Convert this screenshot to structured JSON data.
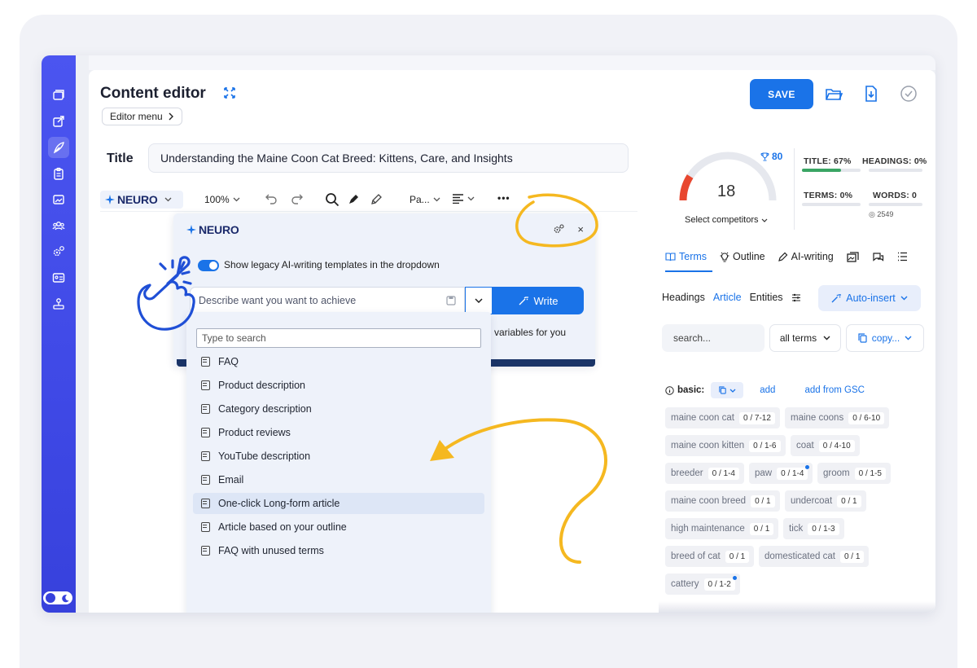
{
  "header": {
    "title": "Content editor",
    "editor_menu_label": "Editor menu",
    "save_label": "SAVE"
  },
  "document": {
    "title_label": "Title",
    "title_value": "Understanding the Maine Coon Cat Breed: Kittens, Care, and Insights"
  },
  "toolbar": {
    "neuro_label": "NEURO",
    "zoom": "100%",
    "paragraph": "Pa...",
    "more": "•••"
  },
  "neuro_popup": {
    "logo": "NEURO",
    "close": "×",
    "toggle_label": "Show legacy AI-writing templates in the dropdown",
    "prompt_placeholder": "Describe want you want to achieve",
    "write_label": "Write",
    "variables_text": "variables for you"
  },
  "template_dropdown": {
    "search_placeholder": "Type to search",
    "items": [
      "FAQ",
      "Product description",
      "Category description",
      "Product reviews",
      "YouTube description",
      "Email",
      "One-click Long-form article",
      "Article based on your outline",
      "FAQ with unused terms"
    ],
    "highlighted_index": 6
  },
  "score": {
    "value": "18",
    "target": "80",
    "gauge_fraction": 0.18,
    "select_competitors": "Select competitors"
  },
  "metrics": {
    "title": "TITLE: 67%",
    "title_fraction": 0.67,
    "headings": "HEADINGS: 0%",
    "terms": "TERMS: 0%",
    "words": "WORDS: 0",
    "word_target": "2549"
  },
  "tabs": [
    {
      "label": "Terms",
      "icon": "book-icon"
    },
    {
      "label": "Outline",
      "icon": "lightbulb-icon"
    },
    {
      "label": "AI-writing",
      "icon": "pen-icon"
    }
  ],
  "subtabs": {
    "headings": "Headings",
    "article": "Article",
    "entities": "Entities",
    "auto_insert": "Auto-insert"
  },
  "filters": {
    "search_placeholder": "search...",
    "all_terms": "all terms",
    "copy": "copy..."
  },
  "basic": {
    "label": "basic:",
    "add": "add",
    "add_gsc": "add from GSC"
  },
  "terms": [
    {
      "term": "maine coon cat",
      "count": "0 / 7-12",
      "dot": false
    },
    {
      "term": "maine coons",
      "count": "0 / 6-10",
      "dot": false
    },
    {
      "term": "maine coon kitten",
      "count": "0 / 1-6",
      "dot": false
    },
    {
      "term": "coat",
      "count": "0 / 4-10",
      "dot": false
    },
    {
      "term": "breeder",
      "count": "0 / 1-4",
      "dot": false
    },
    {
      "term": "paw",
      "count": "0 / 1-4",
      "dot": true
    },
    {
      "term": "groom",
      "count": "0 / 1-5",
      "dot": false
    },
    {
      "term": "maine coon breed",
      "count": "0 / 1",
      "dot": false
    },
    {
      "term": "undercoat",
      "count": "0 / 1",
      "dot": false
    },
    {
      "term": "high maintenance",
      "count": "0 / 1",
      "dot": false
    },
    {
      "term": "tick",
      "count": "0 / 1-3",
      "dot": false
    },
    {
      "term": "breed of cat",
      "count": "0 / 1",
      "dot": false
    },
    {
      "term": "domesticated cat",
      "count": "0 / 1",
      "dot": false
    },
    {
      "term": "cattery",
      "count": "0 / 1-2",
      "dot": true
    }
  ],
  "colors": {
    "accent": "#1a73e8",
    "sidebar": "#4b55f0",
    "gauge_red": "#e8472f",
    "annotation_yellow": "#f5b820",
    "hand_blue": "#1f4fd6"
  }
}
